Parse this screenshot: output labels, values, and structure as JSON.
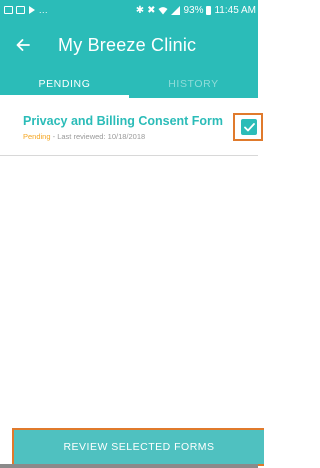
{
  "status_bar": {
    "left_icons": [
      "image-icon",
      "cast-icon",
      "play-icon"
    ],
    "dots": "...",
    "right_icons": [
      "bluetooth-icon",
      "mute-icon",
      "wifi-icon",
      "signal-icon"
    ],
    "battery": "93%",
    "time": "11:45 AM"
  },
  "app_bar": {
    "back_icon": "arrow-back-icon",
    "title": "My Breeze Clinic"
  },
  "tabs": [
    {
      "label": "PENDING",
      "active": true
    },
    {
      "label": "HISTORY",
      "active": false
    }
  ],
  "forms": [
    {
      "title": "Privacy and Billing Consent Form",
      "status": "Pending",
      "separator": " - ",
      "reviewed": "Last reviewed: 10/18/2018",
      "checked": true
    }
  ],
  "review_button": {
    "label": "REVIEW SELECTED FORMS"
  },
  "colors": {
    "primary": "#2bbcb8",
    "pending": "#f5a623",
    "highlight": "#e07a2c",
    "button": "#4fc1c0"
  }
}
